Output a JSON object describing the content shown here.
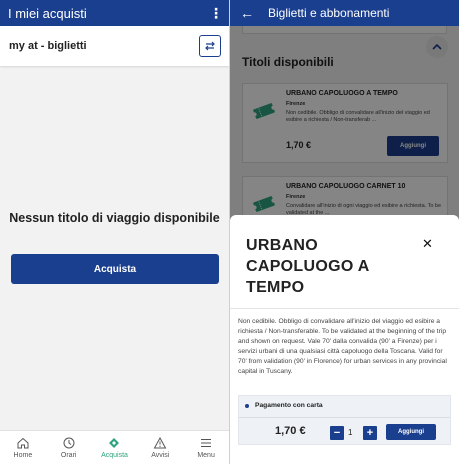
{
  "left": {
    "app_title": "I miei acquisti",
    "selector_label": "my at - biglietti",
    "empty_message": "Nessun titolo di viaggio disponibile",
    "buy_button": "Acquista",
    "nav": [
      {
        "label": "Home",
        "icon": "home-icon"
      },
      {
        "label": "Orari",
        "icon": "clock-icon"
      },
      {
        "label": "Acquista",
        "icon": "ticket-icon",
        "active": true
      },
      {
        "label": "Avvisi",
        "icon": "warning-icon"
      },
      {
        "label": "Menu",
        "icon": "menu-icon"
      }
    ]
  },
  "right": {
    "app_title": "Biglietti e abbonamenti",
    "section_title": "Titoli disponibili",
    "cards": [
      {
        "name": "URBANO CAPOLUOGO A TEMPO",
        "city": "Firenze",
        "description": "Non cedibile. Obbligo di convalidare all'inizio del viaggio ed esibire a richiesta / Non-transferab ...",
        "price": "1,70 €",
        "button": "Aggiungi"
      },
      {
        "name": "URBANO CAPOLUOGO CARNET 10",
        "city": "Firenze",
        "description": "Convalidare all'inizio di ogni viaggio ed esibire a richiesta. To be validated at the ...",
        "price": "",
        "button": ""
      }
    ],
    "sheet": {
      "title": "URBANO CAPOLUOGO A TEMPO",
      "description": "Non cedibile. Obbligo di convalidare all'inizio del viaggio ed esibire a richiesta / Non-transferable. To be validated at the beginning of the trip and shown on request. Vale 70' dalla convalida (90' a Firenze) per i servizi urbani di una qualsiasi città capoluogo della Toscana. Valid for 70' from validation (90' in Florence) for urban services in any provincial capital in Tuscany.",
      "payment_method": "Pagamento con carta",
      "price": "1,70 €",
      "quantity": "1",
      "add_button": "Aggiungi"
    }
  },
  "colors": {
    "primary": "#1b3f8f",
    "accent": "#2fa37f"
  }
}
